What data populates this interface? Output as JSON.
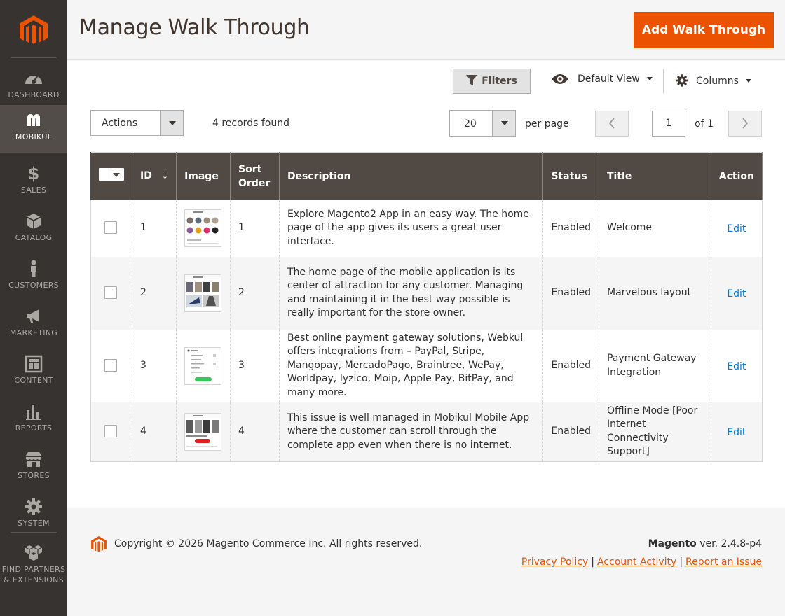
{
  "sidebar": {
    "items": [
      {
        "label": "DASHBOARD",
        "icon": "dashboard-icon"
      },
      {
        "label": "MOBIKUL",
        "icon": "mobikul-icon"
      },
      {
        "label": "SALES",
        "icon": "dollar-icon"
      },
      {
        "label": "CATALOG",
        "icon": "box-icon"
      },
      {
        "label": "CUSTOMERS",
        "icon": "person-icon"
      },
      {
        "label": "MARKETING",
        "icon": "megaphone-icon"
      },
      {
        "label": "CONTENT",
        "icon": "layout-icon"
      },
      {
        "label": "REPORTS",
        "icon": "bar-chart-icon"
      },
      {
        "label": "STORES",
        "icon": "store-icon"
      },
      {
        "label": "SYSTEM",
        "icon": "gear-icon"
      },
      {
        "label_line1": "FIND PARTNERS",
        "label_line2": "& EXTENSIONS",
        "icon": "cubes-icon"
      }
    ],
    "active": "MOBIKUL"
  },
  "header": {
    "title": "Manage Walk Through",
    "add_button": "Add Walk Through"
  },
  "toolbar": {
    "filters": "Filters",
    "view": "Default View",
    "columns": "Columns",
    "actions": "Actions",
    "records": "4 records found",
    "per_page_value": "20",
    "per_page_label": "per page",
    "page": "1",
    "of_pages": "of 1"
  },
  "table": {
    "headers": {
      "id": "ID",
      "id_sort": "↓",
      "image": "Image",
      "sort_order_line1": "Sort",
      "sort_order_line2": "Order",
      "description": "Description",
      "status": "Status",
      "title": "Title",
      "action": "Action"
    },
    "rows": [
      {
        "id": "1",
        "sort_order": "1",
        "description": "Explore Magento2 App in an easy way. The home page of the app gives its users a great user interface.",
        "status": "Enabled",
        "title": "Welcome",
        "action": "Edit"
      },
      {
        "id": "2",
        "sort_order": "2",
        "description": "The home page of the mobile application is its center of attraction for any customer. Managing and maintaining it in the best way possible is really important for the store owner.",
        "status": "Enabled",
        "title": "Marvelous layout",
        "action": "Edit"
      },
      {
        "id": "3",
        "sort_order": "3",
        "description": "Best online payment gateway solutions, Webkul offers integrations from – PayPal, Stripe, Mangopay, MercadoPago, Braintree, WePay, Worldpay, Iyzico, Moip, Apple Pay, BitPay, and many more.",
        "status": "Enabled",
        "title": "Payment Gateway Integration",
        "action": "Edit"
      },
      {
        "id": "4",
        "sort_order": "4",
        "description": "This issue is well managed in Mobikul Mobile App where the customer can scroll through the complete app even when there is no internet.",
        "status": "Enabled",
        "title": "Offline Mode [Poor Internet Connectivity Support]",
        "action": "Edit"
      }
    ]
  },
  "footer": {
    "copyright": "Copyright © 2026 Magento Commerce Inc. All rights reserved.",
    "brand": "Magento",
    "version": " ver. 2.4.8-p4",
    "links": [
      "Privacy Policy",
      "Account Activity",
      "Report an Issue"
    ]
  },
  "colors": {
    "accent": "#eb5202",
    "sidebar": "#373330",
    "table_header": "#514943",
    "link": "#007bdb"
  }
}
